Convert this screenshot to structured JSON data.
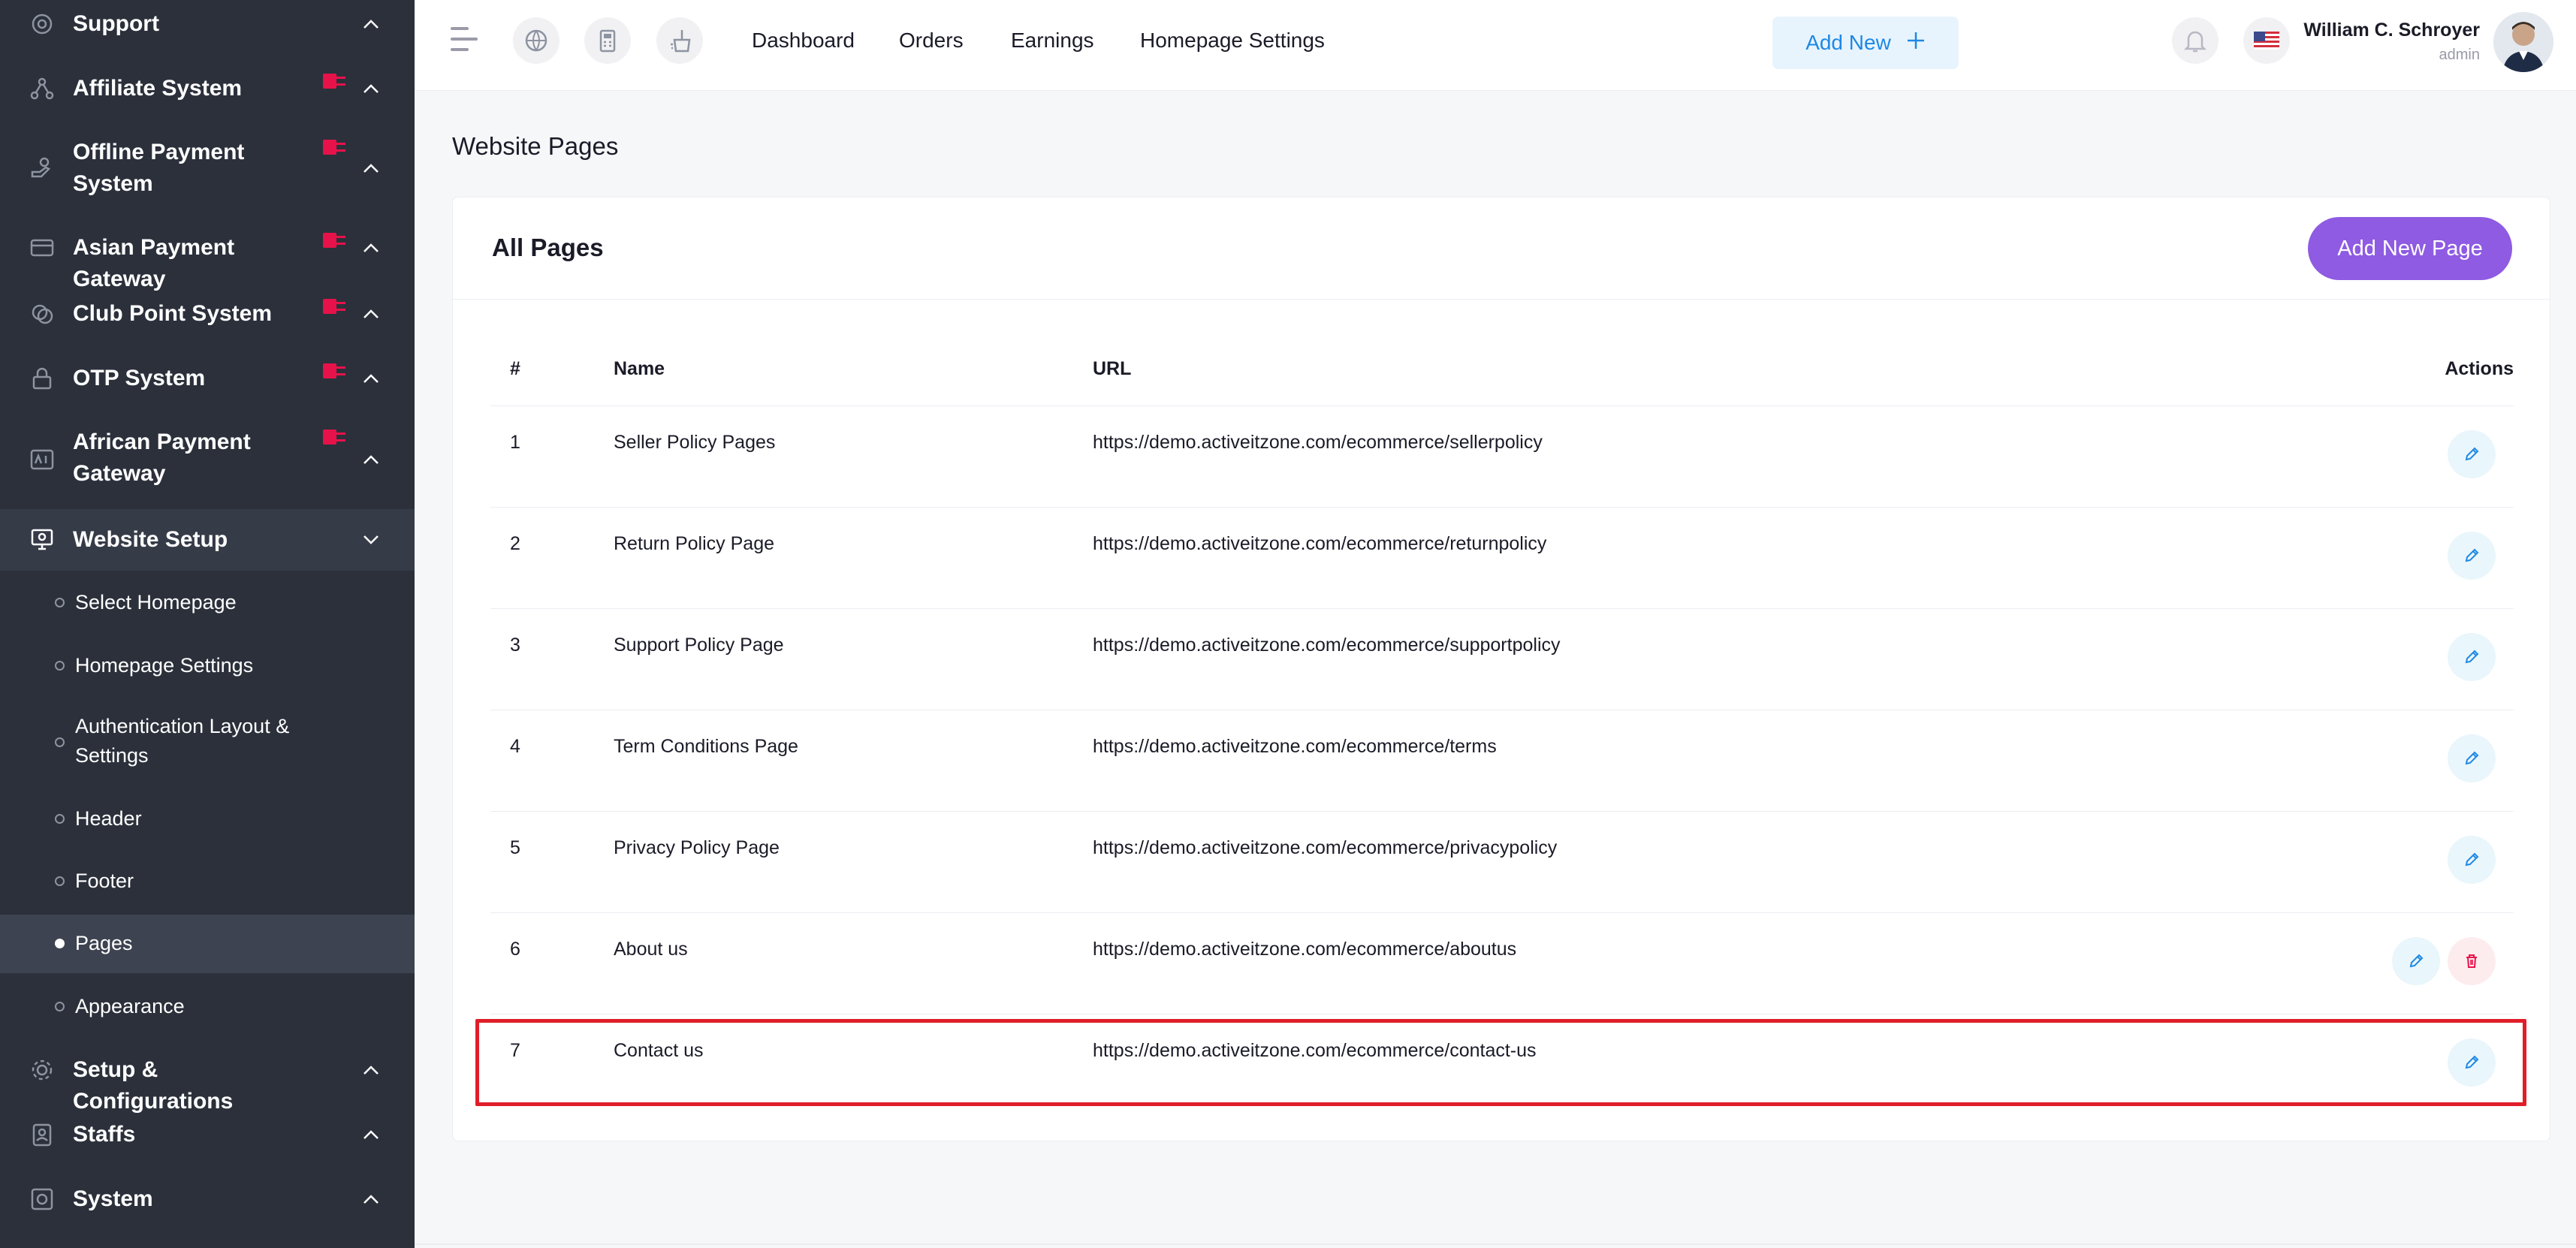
{
  "sidebar": {
    "items": [
      {
        "label": "Support",
        "icon": "support-icon",
        "addon": false
      },
      {
        "label": "Affiliate System",
        "icon": "affiliate-icon",
        "addon": true
      },
      {
        "label": "Offline Payment System",
        "icon": "offline-payment-icon",
        "addon": true
      },
      {
        "label": "Asian Payment Gateway",
        "icon": "asian-payment-icon",
        "addon": true
      },
      {
        "label": "Club Point System",
        "icon": "club-point-icon",
        "addon": true
      },
      {
        "label": "OTP System",
        "icon": "otp-icon",
        "addon": true
      },
      {
        "label": "African Payment Gateway",
        "icon": "african-payment-icon",
        "addon": true
      },
      {
        "label": "Website Setup",
        "icon": "website-setup-icon",
        "addon": false
      }
    ],
    "website_setup_children": [
      {
        "label": "Select Homepage"
      },
      {
        "label": "Homepage Settings"
      },
      {
        "label": "Authentication Layout & Settings"
      },
      {
        "label": "Header"
      },
      {
        "label": "Footer"
      },
      {
        "label": "Pages"
      },
      {
        "label": "Appearance"
      }
    ],
    "bottom_items": [
      {
        "label": "Setup & Configurations",
        "icon": "setup-config-icon"
      },
      {
        "label": "Staffs",
        "icon": "staffs-icon"
      },
      {
        "label": "System",
        "icon": "system-icon"
      }
    ]
  },
  "topbar": {
    "links": [
      "Dashboard",
      "Orders",
      "Earnings",
      "Homepage Settings"
    ],
    "add_new": "Add New",
    "user_name": "William C. Schroyer",
    "user_role": "admin"
  },
  "main": {
    "page_title": "Website Pages",
    "card_title": "All Pages",
    "add_button": "Add New Page",
    "columns": [
      "#",
      "Name",
      "URL",
      "Actions"
    ],
    "rows": [
      {
        "num": "1",
        "name": "Seller Policy Pages",
        "url": "https://demo.activeitzone.com/ecommerce/sellerpolicy",
        "deletable": false
      },
      {
        "num": "2",
        "name": "Return Policy Page",
        "url": "https://demo.activeitzone.com/ecommerce/returnpolicy",
        "deletable": false
      },
      {
        "num": "3",
        "name": "Support Policy Page",
        "url": "https://demo.activeitzone.com/ecommerce/supportpolicy",
        "deletable": false
      },
      {
        "num": "4",
        "name": "Term Conditions Page",
        "url": "https://demo.activeitzone.com/ecommerce/terms",
        "deletable": false
      },
      {
        "num": "5",
        "name": "Privacy Policy Page",
        "url": "https://demo.activeitzone.com/ecommerce/privacypolicy",
        "deletable": false
      },
      {
        "num": "6",
        "name": "About us",
        "url": "https://demo.activeitzone.com/ecommerce/aboutus",
        "deletable": true
      },
      {
        "num": "7",
        "name": "Contact us",
        "url": "https://demo.activeitzone.com/ecommerce/contact-us",
        "deletable": false
      }
    ]
  },
  "colors": {
    "sidebar_bg": "#2b303b",
    "accent_purple": "#8e5be2",
    "accent_blue": "#1e88e5",
    "addon_red": "#e8124a",
    "highlight_red": "#e01e2a"
  }
}
